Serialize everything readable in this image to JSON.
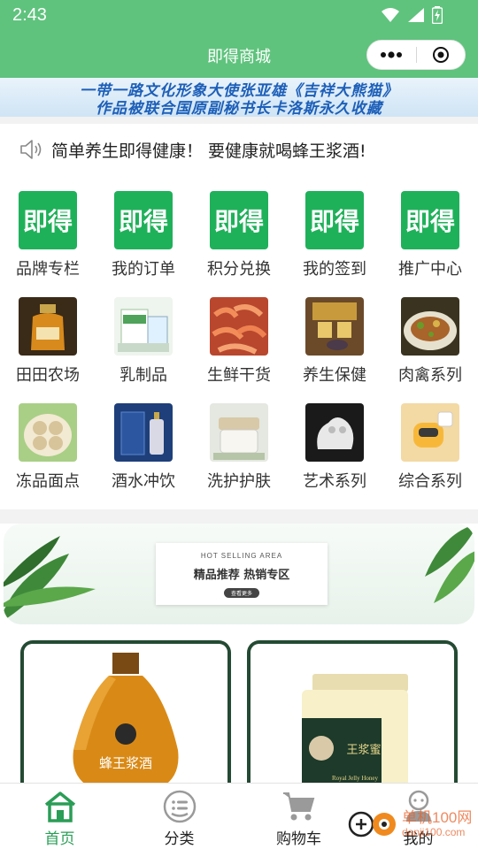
{
  "status_bar": {
    "time": "2:43"
  },
  "header": {
    "title": "即得商城"
  },
  "banner": {
    "line1": "一带一路文化形象大使张亚雄《吉祥大熊猫》",
    "line2": "作品被联合国原副秘书长卡洛斯永久收藏"
  },
  "notice": {
    "text": "简单养生即得健康！ 要健康就喝蜂王浆酒!"
  },
  "menu": {
    "icon_text": "即得",
    "items": [
      {
        "label": "品牌专栏"
      },
      {
        "label": "我的订单"
      },
      {
        "label": "积分兑换"
      },
      {
        "label": "我的签到"
      },
      {
        "label": "推广中心"
      }
    ]
  },
  "categories": [
    {
      "label": "田田农场"
    },
    {
      "label": "乳制品"
    },
    {
      "label": "生鲜干货"
    },
    {
      "label": "养生保健"
    },
    {
      "label": "肉禽系列"
    },
    {
      "label": "冻品面点"
    },
    {
      "label": "酒水冲饮"
    },
    {
      "label": "洗护护肤"
    },
    {
      "label": "艺术系列"
    },
    {
      "label": "综合系列"
    }
  ],
  "promo": {
    "subtitle": "HOT SELLING AREA",
    "title": "精品推荐 热销专区",
    "button": "查看更多"
  },
  "products": [
    {
      "label": "蜂王浆酒"
    },
    {
      "label": "王浆蜜",
      "sub": "Royal Jelly Honey"
    }
  ],
  "tabbar": {
    "items": [
      {
        "label": "首页"
      },
      {
        "label": "分类"
      },
      {
        "label": "购物车"
      },
      {
        "label": "我的"
      }
    ]
  },
  "watermark": {
    "text": "单机100网",
    "url": "danji100.com"
  },
  "colors": {
    "brand_green": "#5fc37d",
    "icon_green": "#1fb15a",
    "active_tab": "#2a9d56"
  }
}
